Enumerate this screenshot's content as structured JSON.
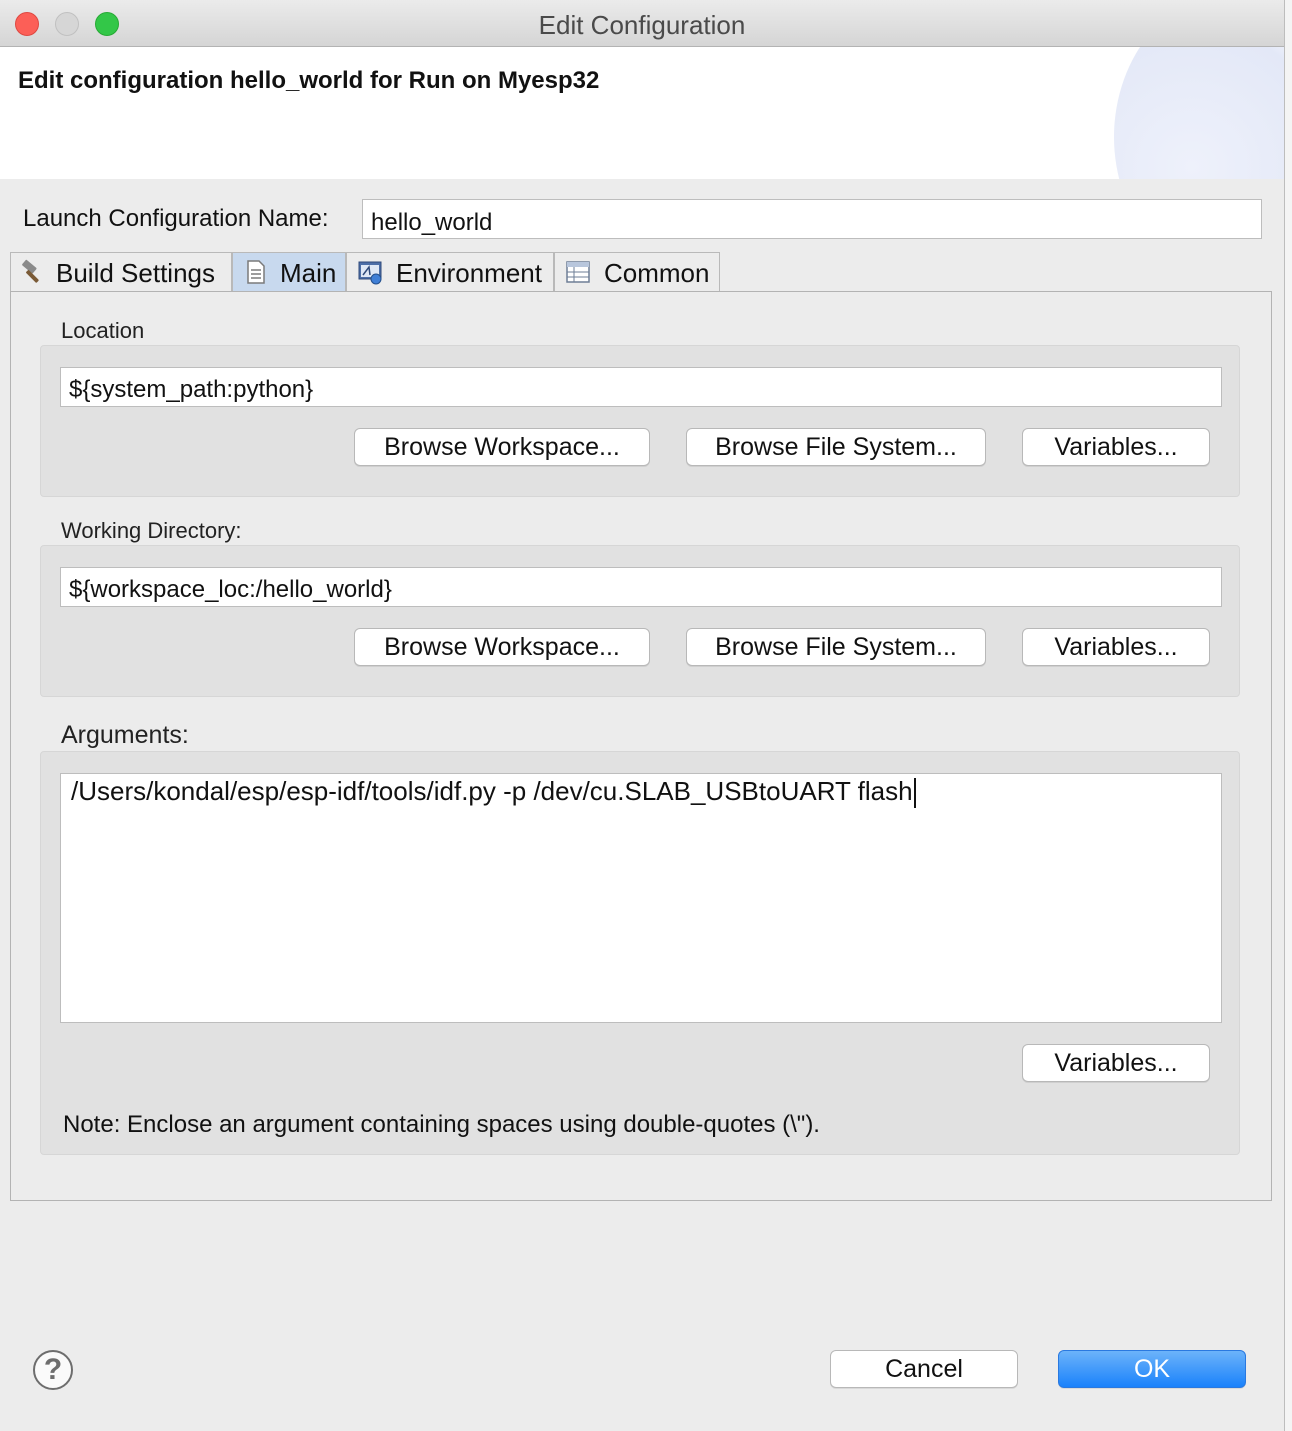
{
  "window": {
    "title": "Edit Configuration"
  },
  "header": {
    "title": "Edit configuration hello_world for Run on Myesp32"
  },
  "launch_name": {
    "label": "Launch Configuration Name:",
    "value": "hello_world"
  },
  "tabs": [
    {
      "label": "Build Settings",
      "icon": "hammer-icon",
      "selected": false
    },
    {
      "label": "Main",
      "icon": "document-icon",
      "selected": true
    },
    {
      "label": "Environment",
      "icon": "environment-icon",
      "selected": false
    },
    {
      "label": "Common",
      "icon": "table-icon",
      "selected": false
    }
  ],
  "location": {
    "label": "Location",
    "value": "${system_path:python}",
    "browse_workspace": "Browse Workspace...",
    "browse_file_system": "Browse File System...",
    "variables": "Variables..."
  },
  "working_directory": {
    "label": "Working Directory:",
    "value": "${workspace_loc:/hello_world}",
    "browse_workspace": "Browse Workspace...",
    "browse_file_system": "Browse File System...",
    "variables": "Variables..."
  },
  "arguments": {
    "label": "Arguments:",
    "value": "/Users/kondal/esp/esp-idf/tools/idf.py -p /dev/cu.SLAB_USBtoUART flash",
    "variables": "Variables...",
    "note": "Note: Enclose an argument containing spaces using double-quotes (\\\")."
  },
  "footer": {
    "help": "?",
    "cancel": "Cancel",
    "ok": "OK"
  },
  "colors": {
    "ok_button": "#1a82fb",
    "selected_tab": "#c8d9ee",
    "close": "#fc5f57",
    "maximize": "#33c748"
  }
}
